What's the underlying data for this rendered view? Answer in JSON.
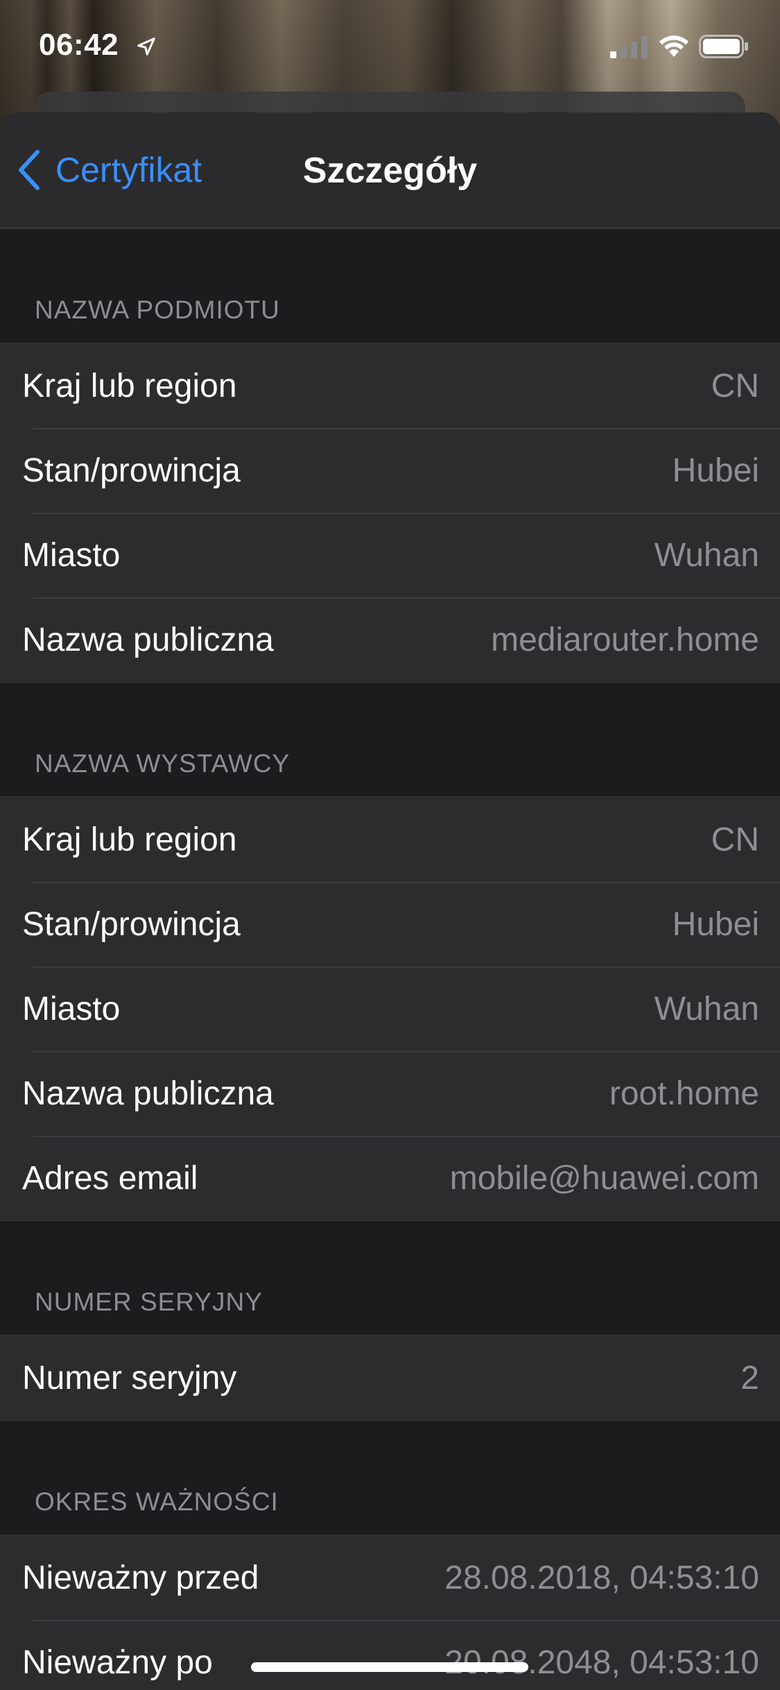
{
  "status_bar": {
    "time": "06:42",
    "icons": [
      "location-arrow-icon",
      "signal-icon",
      "wifi-icon",
      "battery-icon"
    ]
  },
  "nav": {
    "back_label": "Certyfikat",
    "title": "Szczegóły"
  },
  "colors": {
    "accent": "#3a8ffb",
    "background": "#1c1c1e",
    "cell": "#2c2c2e",
    "secondary_text": "#8e8e93"
  },
  "sections": [
    {
      "header": "NAZWA PODMIOTU",
      "rows": [
        {
          "label": "Kraj lub region",
          "value": "CN"
        },
        {
          "label": "Stan/prowincja",
          "value": "Hubei"
        },
        {
          "label": "Miasto",
          "value": "Wuhan"
        },
        {
          "label": "Nazwa publiczna",
          "value": "mediarouter.home"
        }
      ]
    },
    {
      "header": "NAZWA WYSTAWCY",
      "rows": [
        {
          "label": "Kraj lub region",
          "value": "CN"
        },
        {
          "label": "Stan/prowincja",
          "value": "Hubei"
        },
        {
          "label": "Miasto",
          "value": "Wuhan"
        },
        {
          "label": "Nazwa publiczna",
          "value": "root.home"
        },
        {
          "label": "Adres email",
          "value": "mobile@huawei.com"
        }
      ]
    },
    {
      "header": "NUMER SERYJNY",
      "rows": [
        {
          "label": "Numer seryjny",
          "value": "2"
        }
      ]
    },
    {
      "header": "OKRES WAŻNOŚCI",
      "rows": [
        {
          "label": "Nieważny przed",
          "value": "28.08.2018, 04:53:10"
        },
        {
          "label": "Nieważny po",
          "value": "20.08.2048, 04:53:10"
        }
      ]
    }
  ]
}
